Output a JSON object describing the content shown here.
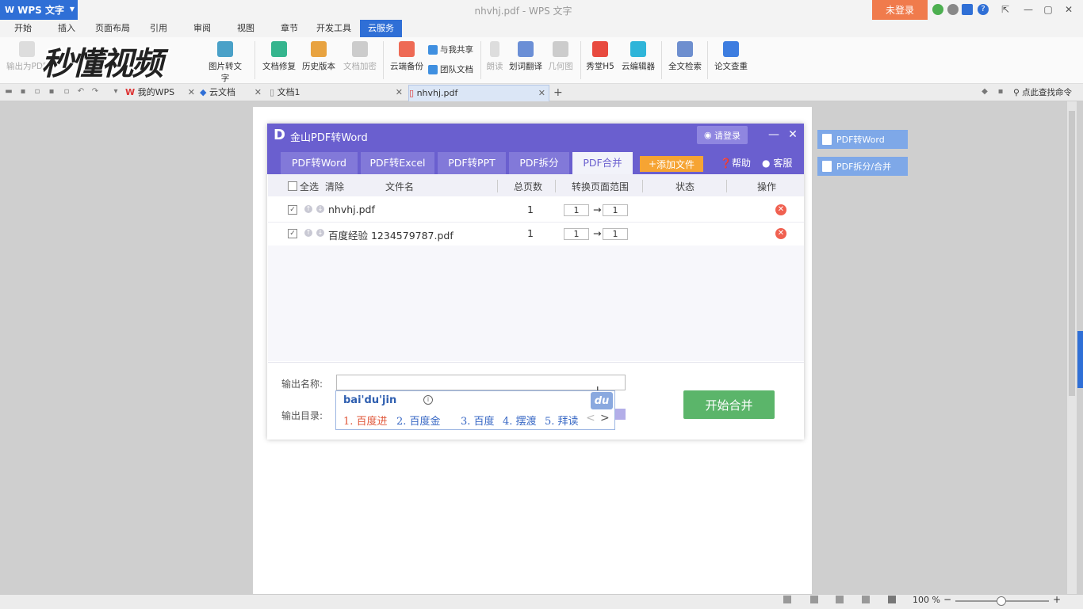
{
  "titlebar": {
    "app_name": "WPS 文字",
    "window_title": "nhvhj.pdf - WPS 文字",
    "login_button": "未登录",
    "window_controls": [
      "—",
      "▢",
      "✕"
    ]
  },
  "menu": [
    "开始",
    "插入",
    "页面布局",
    "引用",
    "审阅",
    "视图",
    "章节",
    "开发工具",
    "云服务"
  ],
  "ribbon": {
    "watermark": "秒懂视频",
    "buttons": [
      {
        "label": "输出为PDF"
      },
      {
        "label": "图片转文字"
      },
      {
        "label": "文档修复"
      },
      {
        "label": "历史版本"
      },
      {
        "label": "文档加密"
      },
      {
        "label": "云端备份"
      },
      {
        "label": "与我共享"
      },
      {
        "label": "团队文档"
      },
      {
        "label": "朗读"
      },
      {
        "label": "划词翻译"
      },
      {
        "label": "几何图"
      },
      {
        "label": "秀堂H5"
      },
      {
        "label": "云编辑器"
      },
      {
        "label": "全文检索"
      },
      {
        "label": "论文查重"
      }
    ]
  },
  "tabs": [
    {
      "label": "我的WPS"
    },
    {
      "label": "云文档"
    },
    {
      "label": "文档1"
    },
    {
      "label": "nhvhj.pdf"
    }
  ],
  "tabbar_right": {
    "find_command": "点此查找命令"
  },
  "side_panel": [
    "PDF转Word",
    "PDF拆分/合并"
  ],
  "dialog": {
    "title": "金山PDF转Word",
    "login": "请登录",
    "tabs": [
      "PDF转Word",
      "PDF转Excel",
      "PDF转PPT",
      "PDF拆分",
      "PDF合并"
    ],
    "active_tab": "PDF合并",
    "add_file": "添加文件",
    "help": "帮助",
    "service": "客服",
    "table": {
      "headers": {
        "select_all": "全选",
        "clear": "清除",
        "filename": "文件名",
        "pages": "总页数",
        "range": "转换页面范围",
        "status": "状态",
        "action": "操作"
      },
      "rows": [
        {
          "checked": "✓",
          "filename": "nhvhj.pdf",
          "pages": "1",
          "from": "1",
          "to": "1"
        },
        {
          "checked": "✓",
          "filename": "百度经验 1234579787.pdf",
          "pages": "1",
          "from": "1",
          "to": "1"
        }
      ]
    },
    "output_name_label": "输出名称:",
    "output_dir_label": "输出目录:",
    "start_button": "开始合并"
  },
  "ime": {
    "pinyin": "bai'du'jin",
    "logo": "du",
    "candidates": [
      "1. 百度进",
      "2. 百度金",
      "3. 百度",
      "4. 摆渡",
      "5. 拜读"
    ],
    "prev": "<",
    "next": ">"
  },
  "statusbar": {
    "zoom": "100 %"
  },
  "colors": {
    "accent": "#6a5fcf",
    "brand": "#2f6fd6",
    "start": "#5bb56a",
    "add": "#f6a433"
  }
}
